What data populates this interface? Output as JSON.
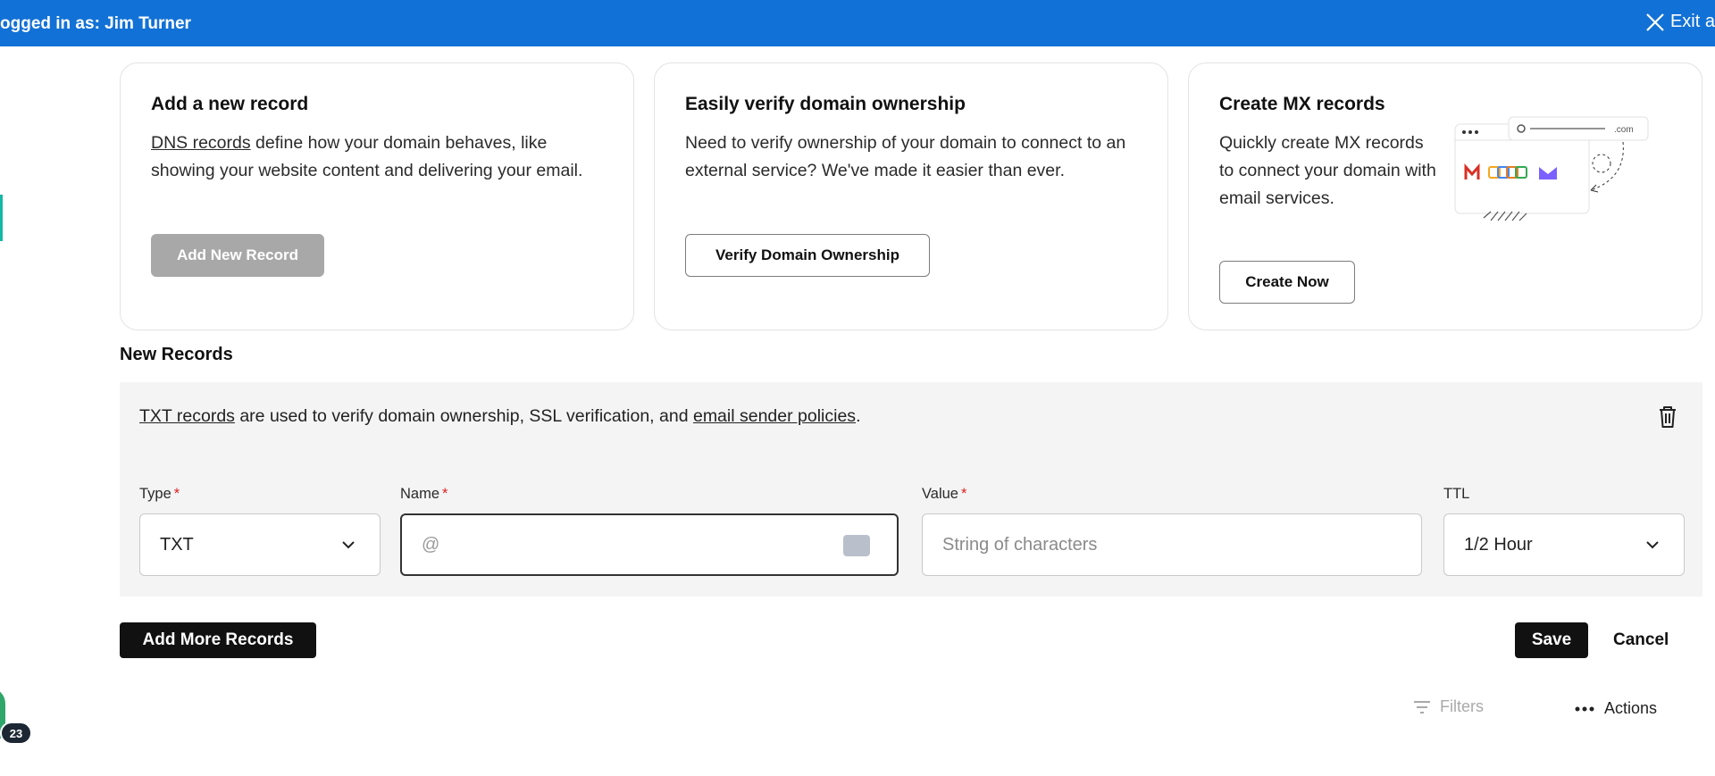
{
  "topbar": {
    "logged_in_text": "ogged in as: Jim Turner",
    "exit_label": "Exit a"
  },
  "cards": [
    {
      "title": "Add a new record",
      "link_text": "DNS records",
      "body_rest": " define how your domain behaves, like showing your website content and delivering your email.",
      "button_label": "Add New Record"
    },
    {
      "title": "Easily verify domain ownership",
      "body": "Need to verify ownership of your domain to connect to an external service? We've made it easier than ever.",
      "button_label": "Verify Domain Ownership"
    },
    {
      "title": "Create MX records",
      "body": "Quickly create MX records to connect your domain with email services.",
      "button_label": "Create Now",
      "illustration_text": ".com"
    }
  ],
  "new_records": {
    "title": "New Records",
    "info_link1": "TXT records",
    "info_middle": " are used to verify domain ownership, SSL verification, and ",
    "info_link2": "email sender policies",
    "info_end": ".",
    "fields": {
      "type_label": "Type",
      "type_value": "TXT",
      "name_label": "Name",
      "name_value": "@",
      "value_label": "Value",
      "value_placeholder": "String of characters",
      "ttl_label": "TTL",
      "ttl_value": "1/2 Hour",
      "required_mark": "*"
    }
  },
  "actions": {
    "add_more_label": "Add More Records",
    "save_label": "Save",
    "cancel_label": "Cancel",
    "filters_label": "Filters",
    "actions_label": "Actions"
  },
  "notification_badge": {
    "count": "23"
  },
  "colors": {
    "topbar": "#1271d6",
    "disabled_button": "#a8a8a8",
    "dark_button": "#111111",
    "panel_bg": "#f4f4f5",
    "required": "#dd2222"
  }
}
